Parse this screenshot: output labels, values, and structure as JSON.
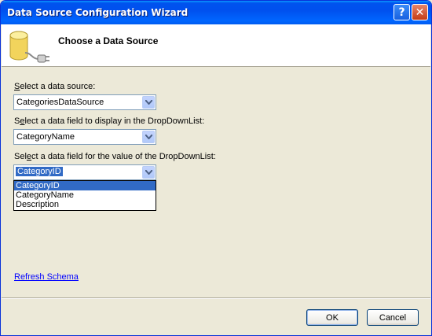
{
  "window": {
    "title": "Data Source Configuration Wizard",
    "help_glyph": "?",
    "close_glyph": "✕"
  },
  "header": {
    "heading": "Choose a Data Source",
    "icon": "database-icon"
  },
  "fields": [
    {
      "label_accel": "S",
      "label_rest": "elect a data source:",
      "value": "CategoriesDataSource"
    },
    {
      "label_pre": "S",
      "label_accel": "e",
      "label_rest": "lect a data field to display in the DropDownList:",
      "value": "CategoryName"
    },
    {
      "label_pre": "Sel",
      "label_accel": "e",
      "label_rest": "ct a data field for the value of the DropDownList:",
      "value": "CategoryID"
    }
  ],
  "dropdown_options": [
    "CategoryID",
    "CategoryName",
    "Description"
  ],
  "refresh_link": "Refresh Schema",
  "buttons": {
    "ok": "OK",
    "cancel": "Cancel"
  },
  "colors": {
    "title_bar": "#0054e3",
    "selection": "#316ac5",
    "dialog_bg": "#ece9d8",
    "link": "#0000ff"
  }
}
